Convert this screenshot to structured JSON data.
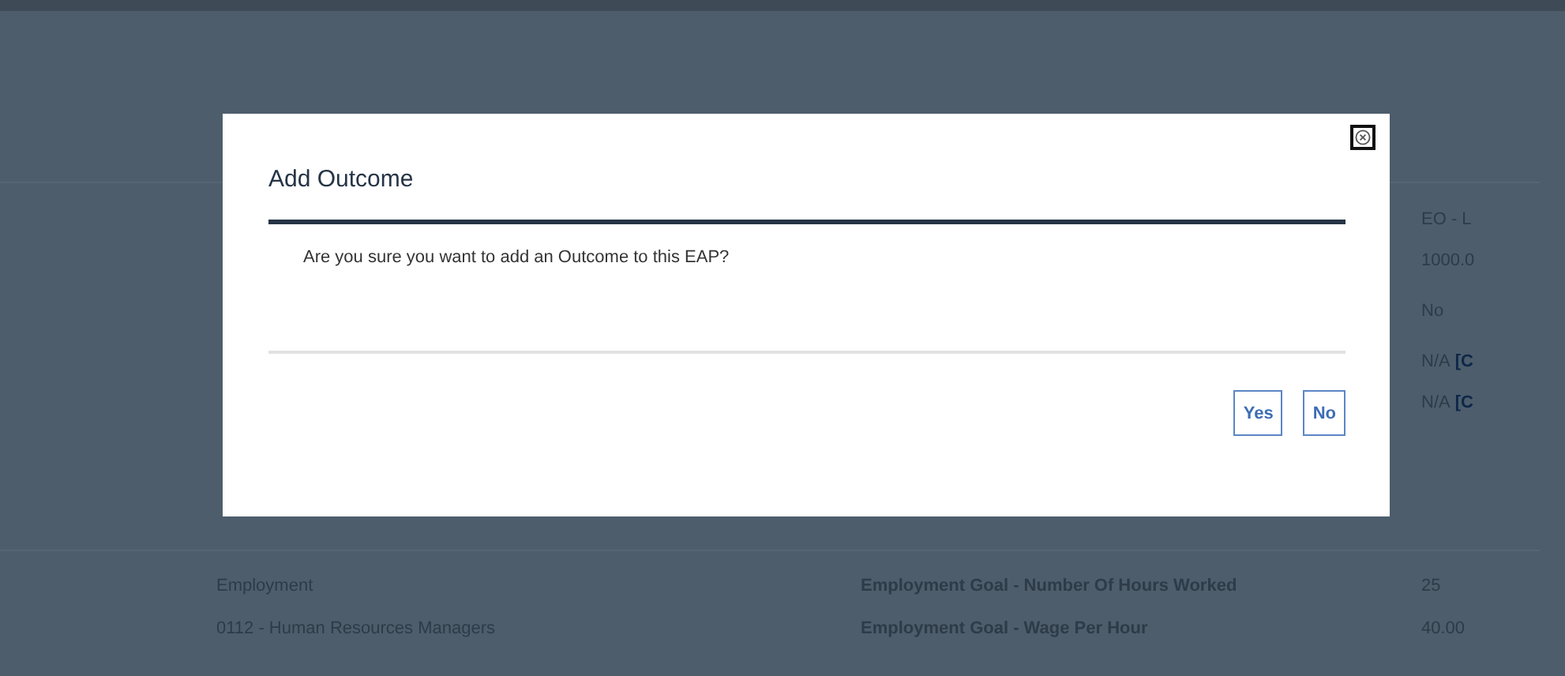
{
  "background": {
    "details": [
      {
        "value": [
          {
            "text": "EO - L",
            "kind": "plain"
          }
        ]
      },
      {
        "value": [
          {
            "text": "1000.0",
            "kind": "plain"
          }
        ]
      },
      {
        "value": [
          {
            "text": "No",
            "kind": "plain"
          }
        ]
      },
      {
        "value": [
          {
            "text": "N/A",
            "kind": "plain"
          },
          {
            "text": "[C",
            "kind": "link"
          }
        ]
      },
      {
        "value": [
          {
            "text": "N/A",
            "kind": "plain"
          },
          {
            "text": "[C",
            "kind": "link"
          }
        ]
      }
    ],
    "goals": [
      {
        "column_1": "Employment",
        "column_2": "Employment Goal - Number Of Hours Worked",
        "column_3": "25"
      },
      {
        "column_1": "0112 - Human Resources Managers",
        "column_2": "Employment Goal - Wage Per Hour",
        "column_3": "40.00"
      }
    ]
  },
  "dialog": {
    "title": "Add Outcome",
    "message": "Are you sure you want to add an Outcome to this EAP?",
    "buttons": [
      {
        "label": "Yes"
      },
      {
        "label": "No"
      }
    ]
  }
}
